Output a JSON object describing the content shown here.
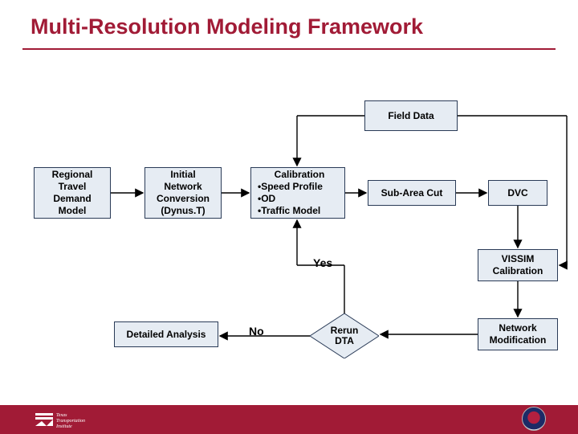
{
  "title": "Multi-Resolution Modeling Framework",
  "boxes": {
    "field_data": "Field Data",
    "regional": "Regional\nTravel\nDemand\nModel",
    "initial": "Initial\nNetwork\nConversion\n(Dynus.T)",
    "calibration_title": "Calibration",
    "calibration_items": [
      "Speed Profile",
      "OD",
      "Traffic Model"
    ],
    "subarea": "Sub-Area Cut",
    "dvc": "DVC",
    "vissim": "VISSIM\nCalibration",
    "netmod": "Network\nModification",
    "rerun": "Rerun\nDTA",
    "detailed": "Detailed Analysis"
  },
  "edges": {
    "yes": "Yes",
    "no": "No"
  },
  "colors": {
    "accent": "#a11b36",
    "box_fill": "#e6ecf3",
    "box_border": "#2a3b57"
  }
}
